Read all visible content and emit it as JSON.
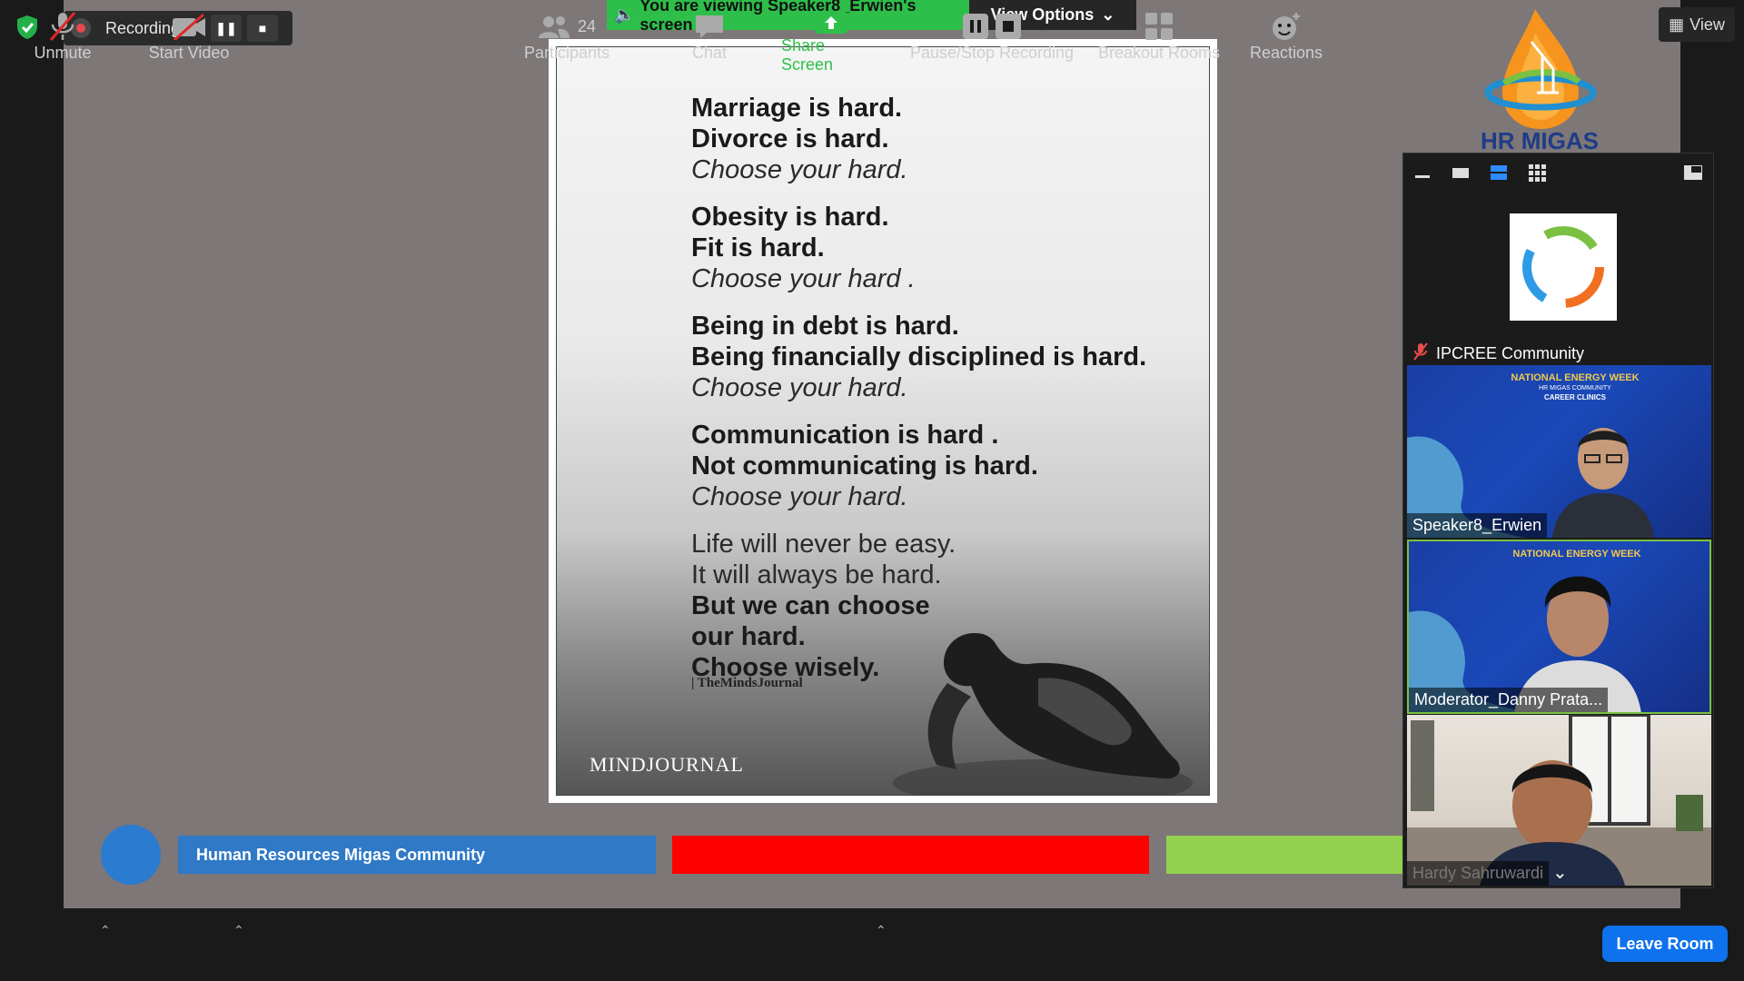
{
  "recording": {
    "label": "Recording..."
  },
  "banner": {
    "viewing_text": "You are viewing Speaker8_Erwien's screen",
    "view_options": "View Options"
  },
  "top_right": {
    "view_label": "View"
  },
  "logo": {
    "text": "HR MIGAS"
  },
  "slide": {
    "blocks": [
      {
        "lines": [
          {
            "t": "Marriage is hard.",
            "s": "bold"
          },
          {
            "t": "Divorce is hard.",
            "s": "bold"
          },
          {
            "t": "Choose your hard.",
            "s": "ital"
          }
        ]
      },
      {
        "lines": [
          {
            "t": "Obesity is hard.",
            "s": "bold"
          },
          {
            "t": "Fit is hard.",
            "s": "bold"
          },
          {
            "t": "Choose your hard .",
            "s": "ital"
          }
        ]
      },
      {
        "lines": [
          {
            "t": "Being in debt is hard.",
            "s": "bold"
          },
          {
            "t": "Being financially disciplined is hard.",
            "s": "bold"
          },
          {
            "t": "Choose your hard.",
            "s": "ital"
          }
        ]
      },
      {
        "lines": [
          {
            "t": "Communication is hard .",
            "s": "bold"
          },
          {
            "t": "Not communicating is hard.",
            "s": "bold"
          },
          {
            "t": "Choose your hard.",
            "s": "ital"
          }
        ]
      },
      {
        "lines": [
          {
            "t": "Life will never be easy.",
            "s": "norm"
          },
          {
            "t": "It will always be hard.",
            "s": "norm"
          },
          {
            "t": "But we can choose",
            "s": "bold"
          },
          {
            "t": "our hard.",
            "s": "bold"
          },
          {
            "t": "Choose wisely.",
            "s": "bold"
          }
        ]
      }
    ],
    "credit": "| TheMindsJournal",
    "brand": "MINDJOURNAL"
  },
  "lower_third": {
    "org_name": "Human Resources Migas Community"
  },
  "panel": {
    "tiles": [
      {
        "name": "IPCREE Community",
        "muted": true
      },
      {
        "name": "Speaker8_Erwien",
        "banner_title": "NATIONAL ENERGY WEEK",
        "banner_sub": "HR MIGAS COMMUNITY",
        "banner_sub2": "CAREER CLINICS"
      },
      {
        "name": "Moderator_Danny Prata...",
        "banner_title": "NATIONAL ENERGY WEEK"
      },
      {
        "name": "Hardy Sahruwardi"
      }
    ]
  },
  "toolbar": {
    "unmute": "Unmute",
    "start_video": "Start Video",
    "participants": "Participants",
    "participants_count": "24",
    "chat": "Chat",
    "share_screen": "Share Screen",
    "pause_stop": "Pause/Stop Recording",
    "breakout": "Breakout Rooms",
    "reactions": "Reactions",
    "leave": "Leave Room"
  },
  "colors": {
    "share_green": "#2dbf4a",
    "leave_blue": "#0e72ed",
    "lt_blue": "#2f79c6",
    "lt_red": "#ff0000",
    "lt_green": "#92d050"
  }
}
